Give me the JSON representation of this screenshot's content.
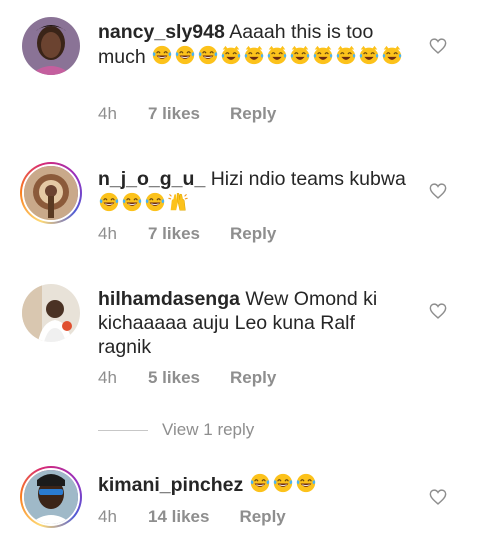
{
  "comments": [
    {
      "username": "nancy_sly948",
      "text": " Aaaah this is too much",
      "emojis": [
        "laugh-cry",
        "laugh-cry",
        "laugh-cry",
        "cat-joy",
        "cat-joy",
        "cat-joy",
        "cat-joy",
        "cat-joy",
        "cat-joy",
        "cat-joy",
        "cat-joy"
      ],
      "time": "4h",
      "likes": "7 likes",
      "reply": "Reply",
      "story_ring": false
    },
    {
      "username": "n_j_o_g_u_",
      "text": " Hizi ndio teams kubwa ",
      "emojis": [
        "laugh-cry",
        "laugh-cry",
        "laugh-cry",
        "raising-hands"
      ],
      "time": "4h",
      "likes": "7 likes",
      "reply": "Reply",
      "story_ring": true
    },
    {
      "username": "hilhamdasenga",
      "text": " Wew Omond ki kichaaaaa auju Leo kuna Ralf ragnik",
      "emojis": [],
      "time": "4h",
      "likes": "5 likes",
      "reply": "Reply",
      "story_ring": false
    },
    {
      "username": "kimani_pinchez",
      "text": " ",
      "emojis": [
        "laugh-cry",
        "laugh-cry",
        "laugh-cry"
      ],
      "time": "4h",
      "likes": "14 likes",
      "reply": "Reply",
      "story_ring": true
    }
  ],
  "view_replies_label": "View 1 reply",
  "icons": {
    "like": "heart-outline-icon"
  },
  "colors": {
    "text": "#262626",
    "meta": "#8e8e8e",
    "emoji_face": "#fcc21b"
  }
}
